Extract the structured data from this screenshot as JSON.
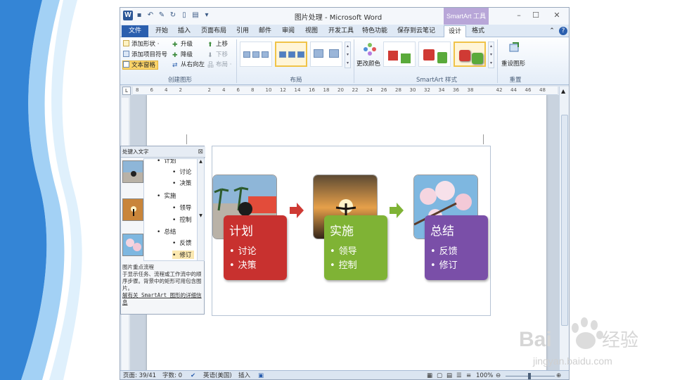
{
  "window": {
    "title": "图片处理 - Microsoft Word",
    "contextual_tab_label": "SmartArt 工具",
    "minimize_icon": "–",
    "maximize_icon": "☐",
    "close_icon": "✕"
  },
  "qat": {
    "word_icon": "W",
    "save": "▪",
    "undo": "↶",
    "redo": "↻",
    "new": "▯",
    "more": "▾"
  },
  "ribbon_tabs": [
    "文件",
    "开始",
    "插入",
    "页面布局",
    "引用",
    "邮件",
    "审阅",
    "视图",
    "开发工具",
    "特色功能",
    "保存到云笔记",
    "设计",
    "格式"
  ],
  "ribbon": {
    "create_graphic": {
      "label": "创建图形",
      "add_shape": "添加形状 ·",
      "add_bullet": "添加项目符号",
      "text_pane": "文本窗格",
      "promote": "升级",
      "demote": "降级",
      "right_to_left": "从右向左",
      "move_up": "上移",
      "move_down": "下移",
      "layout_btn": "布局 ·"
    },
    "layouts": {
      "label": "布局"
    },
    "smartart_styles": {
      "label": "SmartArt 样式",
      "change_colors": "更改颜色"
    },
    "reset": {
      "label": "重置",
      "reset_graphic": "重设图形"
    }
  },
  "ruler": {
    "marks": [
      "8",
      "6",
      "4",
      "2",
      "",
      "2",
      "4",
      "6",
      "8",
      "10",
      "12",
      "14",
      "16",
      "18",
      "20",
      "22",
      "24",
      "26",
      "28",
      "30",
      "32",
      "34",
      "36",
      "38",
      "",
      "42",
      "44",
      "46",
      "48"
    ],
    "corner": "L"
  },
  "smartart": {
    "cards": [
      {
        "title": "计划",
        "bullets": [
          "讨论",
          "决策"
        ],
        "color": "#c8312f"
      },
      {
        "title": "实施",
        "bullets": [
          "领导",
          "控制"
        ],
        "color": "#7fb335"
      },
      {
        "title": "总结",
        "bullets": [
          "反馈",
          "修订"
        ],
        "color": "#7a4fa8"
      }
    ],
    "arrow_colors": [
      "#cf3a34",
      "#7fb335"
    ]
  },
  "text_pane": {
    "header": "处键入文字",
    "items": [
      {
        "text": "计划",
        "level": 1
      },
      {
        "text": "讨论",
        "level": 2
      },
      {
        "text": "决策",
        "level": 2
      },
      {
        "text": "实施",
        "level": 1
      },
      {
        "text": "领导",
        "level": 2
      },
      {
        "text": "控制",
        "level": 2
      },
      {
        "text": "总结",
        "level": 1
      },
      {
        "text": "反馈",
        "level": 2
      },
      {
        "text": "修订",
        "level": 2
      }
    ],
    "description_title": "图片重点流程",
    "description": "于显示任务、流程或工作流中的顺序步骤。背景中的矩形可用包含图片。",
    "link_text": "解有关 SmartArt 图形的详细信息"
  },
  "status_bar": {
    "page": "页面: 39/41",
    "words": "字数: 0",
    "language": "英语(美国)",
    "mode": "插入",
    "zoom": "100%",
    "zoom_minus": "⊖",
    "zoom_plus": "⊕"
  },
  "watermark": {
    "text": "Bai 经验",
    "url": "jingyan.baidu.com"
  }
}
